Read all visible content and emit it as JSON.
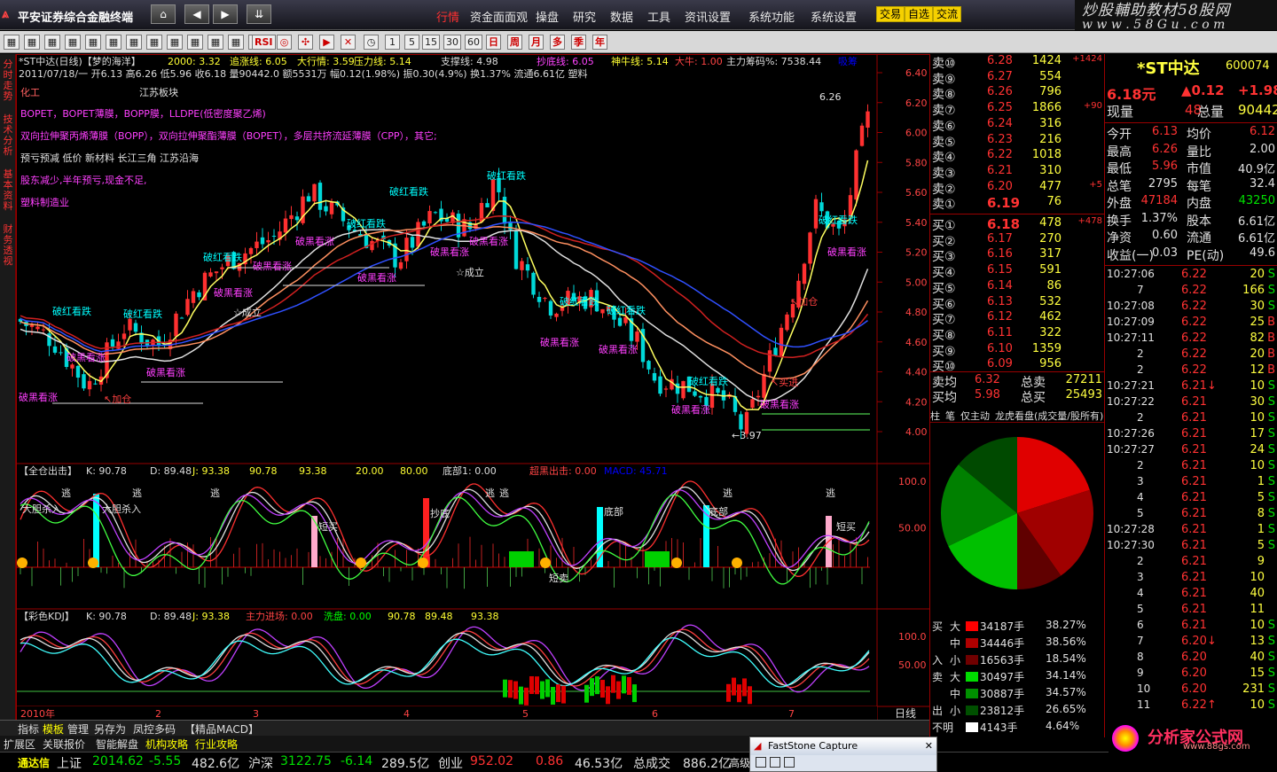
{
  "app": {
    "title": "平安证券综合金融终端",
    "brand": "炒股輔助教材58股网",
    "brand_url": "w w w . 5 8 G u . c o m"
  },
  "menu": [
    "行情",
    "资金面面观",
    "操盘",
    "研究",
    "数据",
    "工具",
    "资讯设置",
    "系统功能",
    "系统设置"
  ],
  "trade_buttons": [
    "交易",
    "自选",
    "交流"
  ],
  "toolbar": {
    "items": [
      "RSI",
      "1",
      "5",
      "15",
      "30",
      "60",
      "日",
      "周",
      "月",
      "多",
      "季",
      "年"
    ]
  },
  "left_tabs": [
    "分时走势",
    "技术分析",
    "基本资料",
    "财务透视"
  ],
  "main_chart": {
    "header1": [
      "*ST中达(日线)【梦的海洋】",
      "2000: 3.32",
      "追涨线: 6.05",
      "大行情: 3.59",
      "压力线: 5.14",
      "支撑线: 4.98",
      "抄底线: 6.05",
      "神牛线: 5.14",
      "大牛: 1.00",
      "主力筹码%: 7538.44",
      "吸筹"
    ],
    "header2": "2011/07/18/一 开6.13 高6.26 低5.96 收6.18 量90442.0 额5531万 幅0.12(1.98%) 振0.30(4.9%) 换1.37% 流通6.61亿 塑料",
    "info_lines": [
      {
        "text": "化工",
        "color": "#ff6060"
      },
      {
        "text": "江苏板块",
        "color": "#e0e0e0"
      },
      {
        "text": "BOPET，BOPET薄膜，BOPP膜，LLDPE(低密度聚乙烯)",
        "color": "#ff40ff"
      },
      {
        "text": "双向拉伸聚丙烯薄膜（BOPP），双向拉伸聚酯薄膜（BOPET），多层共挤流延薄膜（CPP），其它;",
        "color": "#ff40ff"
      },
      {
        "text": "预亏预减 低价 新材料 长江三角 江苏沿海",
        "color": "#e0e0e0"
      },
      {
        "text": "股东减少,半年预亏,现金不足,",
        "color": "#ff40ff"
      },
      {
        "text": "塑料制造业",
        "color": "#ff40ff"
      }
    ],
    "price_ticks": [
      "6.40",
      "6.20",
      "6.00",
      "5.80",
      "5.60",
      "5.40",
      "5.20",
      "5.00",
      "4.80",
      "4.60",
      "4.40",
      "4.20",
      "4.00"
    ],
    "annotations": [
      "6.26",
      "3.97",
      "破红看跌",
      "破黑看涨",
      "☆成立",
      "↖加仓",
      "买进",
      "☆成立"
    ],
    "xaxis": [
      "2010年",
      "2",
      "3",
      "4",
      "5",
      "6",
      "7"
    ],
    "period": "日线"
  },
  "ind1": {
    "header": [
      "【全仓出击】",
      "K: 90.78",
      "D: 89.48",
      "J: 93.38",
      "90.78",
      "93.38",
      "20.00",
      "80.00",
      "底部1: 0.00",
      "超黑出击: 0.00",
      "MACD: 45.71"
    ],
    "ticks": [
      "100.0",
      "50.00"
    ],
    "labels": [
      "逃",
      "逃",
      "逃",
      "逃",
      "逃",
      "逃",
      "逃",
      "大胆杀入",
      "大胆杀入",
      "抄底",
      "底部",
      "底部",
      "短买",
      "短买",
      "短卖"
    ]
  },
  "ind2": {
    "header": [
      "【彩色KDJ】",
      "K: 90.78",
      "D: 89.48",
      "J: 93.38",
      "主力进场: 0.00",
      "洗盘: 0.00",
      "90.78",
      "89.48",
      "93.38"
    ],
    "ticks": [
      "100.0",
      "50.00"
    ]
  },
  "bottom_tabs": [
    "指标",
    "模板",
    "管理",
    "另存为",
    "凤控多码",
    "【精品MACD】"
  ],
  "bottom_tabs2": [
    "扩展区",
    "关联报价",
    "智能解盘",
    "机构攻略",
    "行业攻略"
  ],
  "orderbook": {
    "sells": [
      [
        "卖⑩",
        "6.28",
        "1424",
        "+1424"
      ],
      [
        "卖⑨",
        "6.27",
        "554",
        ""
      ],
      [
        "卖⑧",
        "6.26",
        "796",
        ""
      ],
      [
        "卖⑦",
        "6.25",
        "1866",
        "+90"
      ],
      [
        "卖⑥",
        "6.24",
        "316",
        ""
      ],
      [
        "卖⑤",
        "6.23",
        "216",
        ""
      ],
      [
        "卖④",
        "6.22",
        "1018",
        ""
      ],
      [
        "卖③",
        "6.21",
        "310",
        ""
      ],
      [
        "卖②",
        "6.20",
        "477",
        "+5"
      ],
      [
        "卖①",
        "6.19",
        "76",
        ""
      ]
    ],
    "buys": [
      [
        "买①",
        "6.18",
        "478",
        "+478"
      ],
      [
        "买②",
        "6.17",
        "270",
        ""
      ],
      [
        "买③",
        "6.16",
        "317",
        ""
      ],
      [
        "买④",
        "6.15",
        "591",
        ""
      ],
      [
        "买⑤",
        "6.14",
        "86",
        ""
      ],
      [
        "买⑥",
        "6.13",
        "532",
        ""
      ],
      [
        "买⑦",
        "6.12",
        "462",
        ""
      ],
      [
        "买⑧",
        "6.11",
        "322",
        ""
      ],
      [
        "买⑨",
        "6.10",
        "1359",
        ""
      ],
      [
        "买⑩",
        "6.09",
        "956",
        ""
      ]
    ],
    "avg": [
      [
        "卖均",
        "6.32",
        "总卖",
        "27211"
      ],
      [
        "买均",
        "5.98",
        "总买",
        "25493"
      ]
    ]
  },
  "pie": {
    "tabs": [
      "柱",
      "笔",
      "仅主动",
      "龙虎看盘(成交量/股所有)"
    ],
    "slices": [
      {
        "name": "买大",
        "value": 38.27,
        "color": "#e00000"
      },
      {
        "name": "买中",
        "value": 38.56,
        "color": "#a00000"
      },
      {
        "name": "买小",
        "value": 18.54,
        "color": "#600000"
      },
      {
        "name": "卖大",
        "value": 34.14,
        "color": "#00c000"
      },
      {
        "name": "卖中",
        "value": 34.57,
        "color": "#008000"
      },
      {
        "name": "卖小",
        "value": 26.65,
        "color": "#004a00"
      }
    ],
    "legend": [
      [
        "买",
        "大",
        "34187手",
        "38.27%",
        "#ff0000"
      ],
      [
        "",
        "中",
        "34446手",
        "38.56%",
        "#b00000"
      ],
      [
        "入",
        "小",
        "16563手",
        "18.54%",
        "#700000"
      ],
      [
        "卖",
        "大",
        "30497手",
        "34.14%",
        "#00dd00"
      ],
      [
        "",
        "中",
        "30887手",
        "34.57%",
        "#009000"
      ],
      [
        "出",
        "小",
        "23812手",
        "26.65%",
        "#005000"
      ]
    ],
    "unknown": [
      "不明",
      "4143手",
      "4.64%"
    ]
  },
  "quote": {
    "name": "*ST中达",
    "code": "600074",
    "price": "6.18元",
    "change": "▲0.12",
    "change2": "+1.98",
    "now_label": "现量",
    "now": "48",
    "total_label": "总量",
    "total": "90442",
    "rows": [
      [
        "今开",
        "6.13",
        "均价",
        "6.12"
      ],
      [
        "最高",
        "6.26",
        "量比",
        "2.00"
      ],
      [
        "最低",
        "5.96",
        "市值",
        "40.9亿"
      ],
      [
        "总笔",
        "2795",
        "每笔",
        "32.4"
      ],
      [
        "外盘",
        "47184",
        "内盘",
        "43250"
      ],
      [
        "换手",
        "1.37%",
        "股本",
        "6.61亿"
      ],
      [
        "净资",
        "0.60",
        "流通",
        "6.61亿"
      ],
      [
        "收益(一)",
        "0.03",
        "PE(动)",
        "49.6"
      ]
    ]
  },
  "ticks": [
    [
      "10:27:06",
      "6.22",
      "20",
      "S"
    ],
    [
      "7",
      "6.22",
      "166",
      "S"
    ],
    [
      "10:27:08",
      "6.22",
      "30",
      "S"
    ],
    [
      "10:27:09",
      "6.22",
      "25",
      "B"
    ],
    [
      "10:27:11",
      "6.22",
      "82",
      "B"
    ],
    [
      "2",
      "6.22",
      "20",
      "B"
    ],
    [
      "2",
      "6.22",
      "12",
      "B"
    ],
    [
      "10:27:21",
      "6.21↓",
      "10",
      "S"
    ],
    [
      "10:27:22",
      "6.21",
      "30",
      "S"
    ],
    [
      "2",
      "6.21",
      "10",
      "S"
    ],
    [
      "10:27:26",
      "6.21",
      "17",
      "S"
    ],
    [
      "10:27:27",
      "6.21",
      "24",
      "S"
    ],
    [
      "2",
      "6.21",
      "10",
      "S"
    ],
    [
      "3",
      "6.21",
      "1",
      "S"
    ],
    [
      "4",
      "6.21",
      "5",
      "S"
    ],
    [
      "5",
      "6.21",
      "8",
      "S"
    ],
    [
      "10:27:28",
      "6.21",
      "1",
      "S"
    ],
    [
      "10:27:30",
      "6.21",
      "5",
      "S"
    ],
    [
      "2",
      "6.21",
      "9",
      ""
    ],
    [
      "3",
      "6.21",
      "10",
      ""
    ],
    [
      "4",
      "6.21",
      "40",
      ""
    ],
    [
      "5",
      "6.21",
      "11",
      ""
    ],
    [
      "6",
      "6.21",
      "10",
      "S"
    ],
    [
      "7",
      "6.20↓",
      "13",
      "S"
    ],
    [
      "8",
      "6.20",
      "40",
      "S"
    ],
    [
      "9",
      "6.20",
      "15",
      "S"
    ],
    [
      "10",
      "6.20",
      "231",
      "S"
    ],
    [
      "11",
      "6.22↑",
      "10",
      "S"
    ]
  ],
  "statusbar": {
    "app": "通达信",
    "items": [
      [
        "上证",
        "2014.62",
        "-5.55",
        "482.6亿"
      ],
      [
        "沪深",
        "3122.75",
        "-6.14",
        "289.5亿"
      ],
      [
        "创业",
        "952.02",
        "0.86",
        "46.53亿"
      ]
    ],
    "total_label": "总成交",
    "total": "886.2亿",
    "extra": "高级"
  },
  "popup": {
    "title": "FastStone Capture"
  },
  "logo": {
    "text": "分析家公式网",
    "url": "www.88gs.com"
  }
}
